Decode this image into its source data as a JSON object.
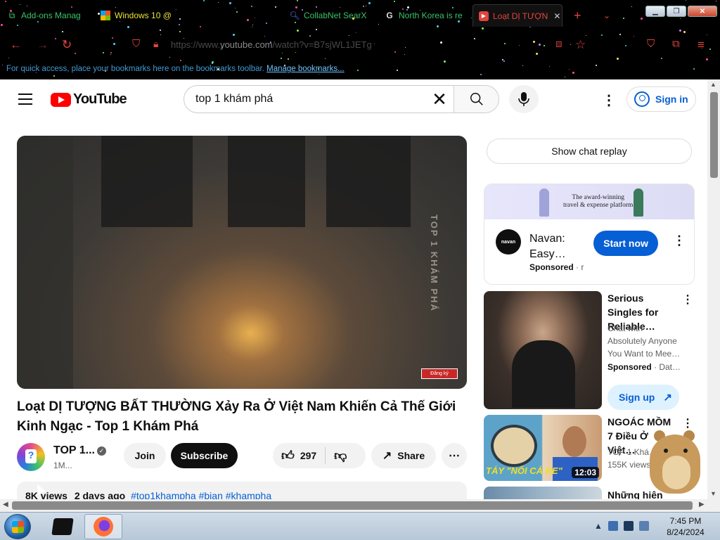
{
  "browser": {
    "tabs": [
      {
        "label": "Add-ons Manag",
        "icon": "puzzle-icon",
        "color": "#3ac26a"
      },
      {
        "label": "Windows 10 @",
        "icon": "windows-icon",
        "color": "#e8e23a"
      },
      {
        "label": "CollabNet SearX",
        "icon": "search-icon",
        "color": "#3ac26a"
      },
      {
        "label": "North Korea is re",
        "icon": "g-icon",
        "color": "#3ac26a"
      },
      {
        "label": "Loạt DỊ TƯỢN",
        "icon": "youtube-icon",
        "color": "#e0453f"
      }
    ],
    "new_tab": "+",
    "url_prefix": "https://www.",
    "url_domain": "youtube.com",
    "url_path": "/watch?v=B7sjWL1JETg",
    "bookmarks_text": "For quick access, place your bookmarks here on the bookmarks toolbar.",
    "bookmarks_link": "Manage bookmarks..."
  },
  "youtube": {
    "logo_text": "YouTube",
    "search_value": "top 1 khám phá",
    "sign_in": "Sign in",
    "video_watermark": "TOP 1 KHÁM PHÁ",
    "video_badge": "Đăng ký",
    "title": "Loạt DỊ TƯỢNG BẤT THƯỜNG Xảy Ra Ở Việt Nam Khiến Cả Thế Giới Kinh Ngạc - Top 1 Khám Phá",
    "channel_name": "TOP 1...",
    "channel_subs": "1M...",
    "join": "Join",
    "subscribe": "Subscribe",
    "likes": "297",
    "share": "Share",
    "desc_views": "8K views",
    "desc_date": "2 days ago",
    "desc_tags": "#top1khampha #bian #khampha"
  },
  "sidebar": {
    "chat_replay": "Show chat replay",
    "ad": {
      "banner_text_1": "The award-winning",
      "banner_text_2": "travel & expense platform",
      "logo": "navan",
      "name": "Navan: Easy…",
      "sponsored": "Sponsored",
      "sponsored_suffix": " · r",
      "cta": "Start now"
    },
    "rec1": {
      "title": "Serious Singles for Reliable…",
      "desc": "Chat with Absolutely Anyone You Want to Mee…",
      "sponsored": "Sponsored",
      "suffix": " · Dat…",
      "cta": "Sign up"
    },
    "rec2": {
      "title": "NGOÁC MỒM 7 Điều Ở Việt…",
      "channel": "TOP 1 Khá…",
      "views": "155K views",
      "duration": "12:03",
      "caption": "TÁY \"NỐI CÁ RE\""
    },
    "rec3": {
      "title": "Những hiện"
    }
  },
  "taskbar": {
    "time": "7:45 PM",
    "date": "8/24/2024"
  }
}
